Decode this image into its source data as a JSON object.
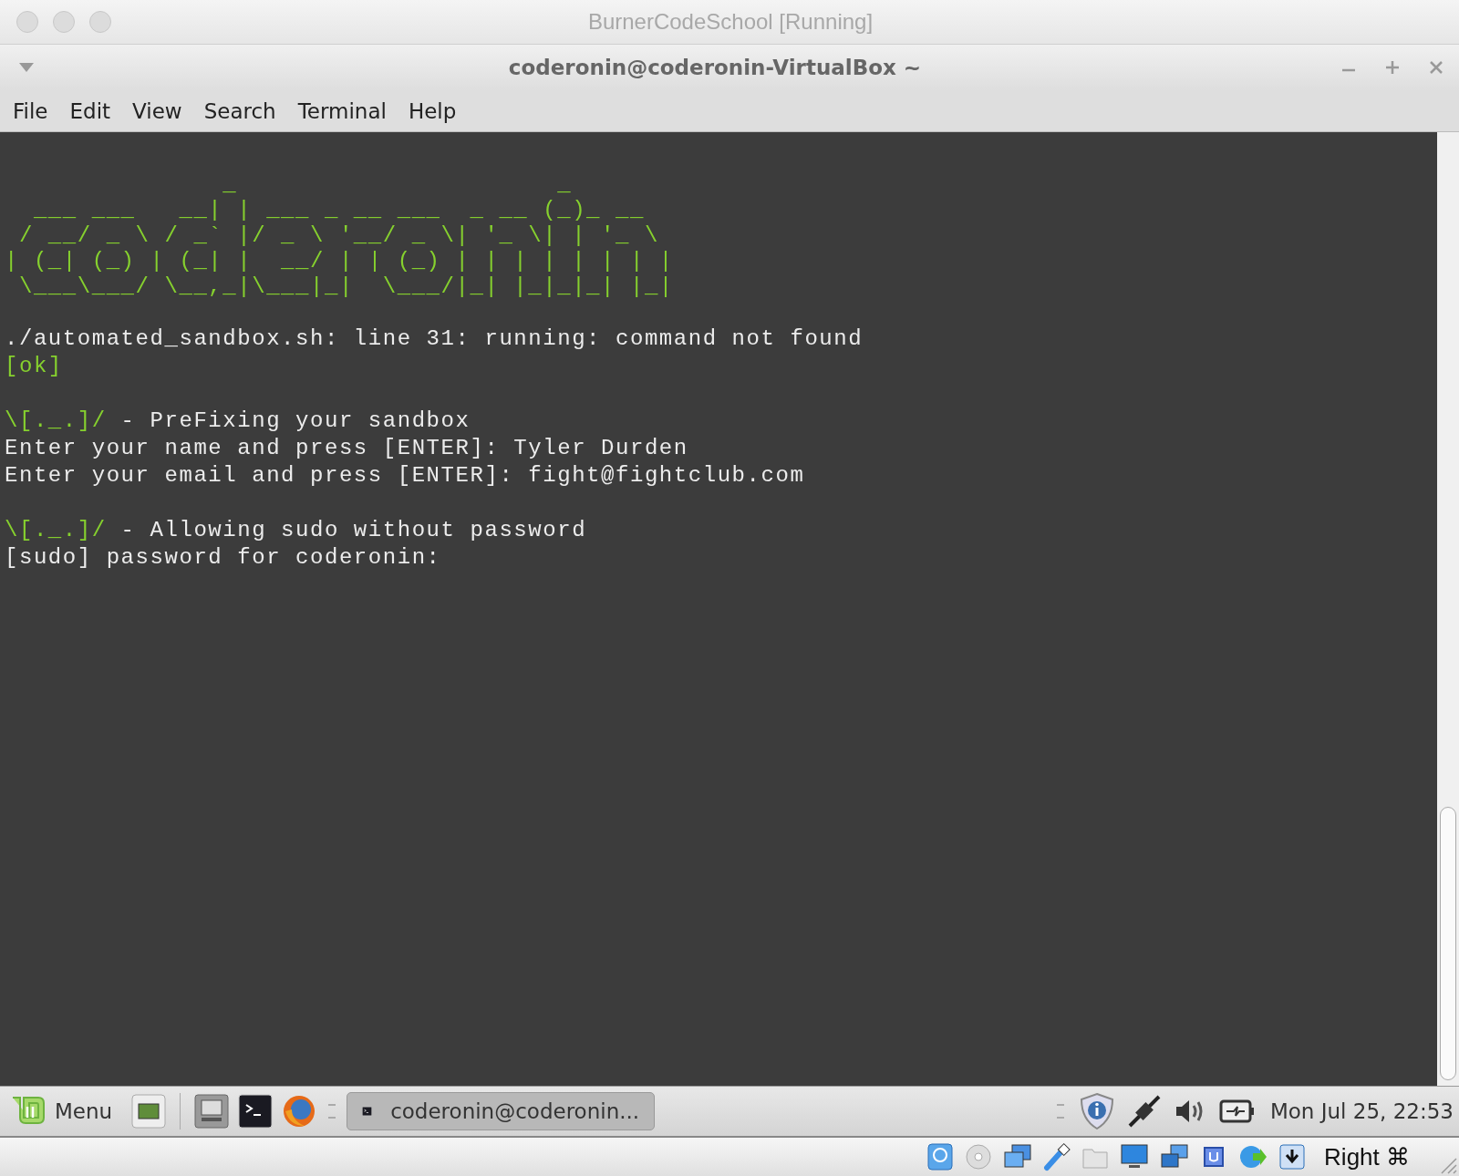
{
  "host_window": {
    "title": "BurnerCodeSchool [Running]"
  },
  "terminal_window": {
    "title": "coderonin@coderonin-VirtualBox ~"
  },
  "menu": [
    "File",
    "Edit",
    "View",
    "Search",
    "Terminal",
    "Help"
  ],
  "banner": "               _                      _\n  ___ ___   __| | ___ _ __ ___  _ __ (_)_ __\n / __/ _ \\ / _` |/ _ \\ '__/ _ \\| '_ \\| | '_ \\\n| (_| (_) | (_| |  __/ | | (_) | | | | | | | |\n \\___\\___/ \\__,_|\\___|_|  \\___/|_| |_|_|_| |_|",
  "output_blocks": [
    [
      [
        {
          "text": "./automated_sandbox.sh: line 31: running: command not found",
          "kind": "plain"
        }
      ],
      [
        {
          "text": "[ok]",
          "kind": "green"
        }
      ]
    ],
    [
      [
        {
          "text": "\\[._.]/",
          "kind": "green"
        },
        {
          "text": " - PreFixing your sandbox",
          "kind": "plain"
        }
      ],
      [
        {
          "text": "Enter your name and press [ENTER]: Tyler Durden",
          "kind": "plain"
        }
      ],
      [
        {
          "text": "Enter your email and press [ENTER]: fight@fightclub.com",
          "kind": "plain"
        }
      ]
    ],
    [
      [
        {
          "text": "\\[._.]/",
          "kind": "green"
        },
        {
          "text": " - Allowing sudo without password",
          "kind": "plain"
        }
      ],
      [
        {
          "text": "[sudo] password for coderonin:",
          "kind": "plain"
        }
      ]
    ]
  ],
  "taskbar": {
    "menu_label": "Menu",
    "window_button": {
      "label": "coderonin@coderonin...",
      "selected": true
    },
    "clock": "Mon Jul 25, 22:53"
  },
  "vbox_status": {
    "host_key": "Right ⌘"
  }
}
